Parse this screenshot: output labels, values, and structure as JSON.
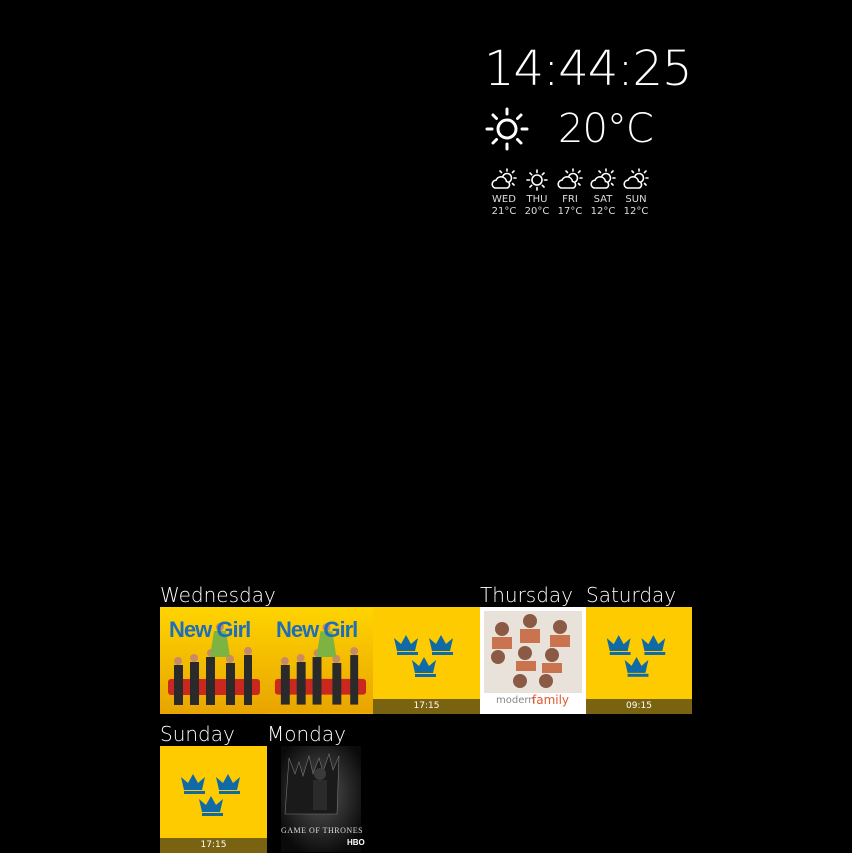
{
  "clock": {
    "time": "14:44:25"
  },
  "current_weather": {
    "temp": "20°C",
    "icon": "sun-icon"
  },
  "forecast": [
    {
      "day": "WED",
      "temp": "21°C",
      "icon": "partly-cloudy-icon"
    },
    {
      "day": "THU",
      "temp": "20°C",
      "icon": "sun-icon"
    },
    {
      "day": "FRI",
      "temp": "17°C",
      "icon": "partly-cloudy-icon"
    },
    {
      "day": "SAT",
      "temp": "12°C",
      "icon": "partly-cloudy-icon"
    },
    {
      "day": "SUN",
      "temp": "12°C",
      "icon": "partly-cloudy-icon"
    }
  ],
  "schedule": {
    "days": [
      "Wednesday",
      "Thursday",
      "Saturday",
      "Sunday",
      "Monday"
    ],
    "tiles": [
      {
        "day": "Wednesday",
        "show": "New Girl",
        "logo": "New Girl",
        "time": ""
      },
      {
        "day": "Wednesday",
        "show": "New Girl",
        "logo": "New Girl",
        "time": ""
      },
      {
        "day": "Wednesday",
        "show": "three-crowns",
        "logo": "",
        "time": "17:15"
      },
      {
        "day": "Thursday",
        "show": "Modern Family",
        "logo_a": "modern",
        "logo_b": "family",
        "time": ""
      },
      {
        "day": "Saturday",
        "show": "three-crowns",
        "logo": "",
        "time": "09:15"
      },
      {
        "day": "Sunday",
        "show": "three-crowns",
        "logo": "",
        "time": "17:15"
      },
      {
        "day": "Monday",
        "show": "Game of Thrones",
        "logo": "GAME OF THRONES",
        "network": "HBO",
        "time": ""
      }
    ]
  },
  "colors": {
    "background": "#000000",
    "tile_yellow": "#fecb00",
    "crown_blue": "#0f6aa6",
    "time_bar": "#7a6310"
  }
}
